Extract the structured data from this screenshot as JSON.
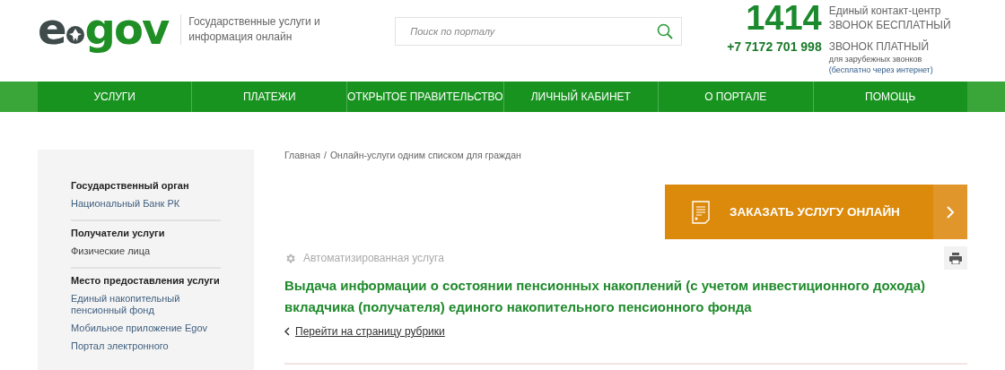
{
  "header": {
    "logo": {
      "left": "e",
      "right": "gov"
    },
    "tagline": "Государственные услуги и информация онлайн",
    "search": {
      "placeholder": "Поиск по порталу"
    },
    "contact": {
      "short_number": "1414",
      "short_label": "Единый контакт-центр",
      "short_note": "ЗВОНОК БЕСПЛАТНЫЙ",
      "phone": "+7 7172 701 998",
      "phone_note": "ЗВОНОК ПЛАТНЫЙ",
      "foreign_note": "для зарубежных звонков",
      "internet_note": "(бесплатно через интернет)"
    }
  },
  "nav": [
    "УСЛУГИ",
    "ПЛАТЕЖИ",
    "ОТКРЫТОЕ ПРАВИТЕЛЬСТВО",
    "ЛИЧНЫЙ КАБИНЕТ",
    "О ПОРТАЛЕ",
    "ПОМОЩЬ"
  ],
  "sidebar": [
    {
      "heading": "Государственный орган",
      "items": [
        {
          "text": "Национальный Банк РК",
          "kind": "link"
        }
      ]
    },
    {
      "heading": "Получатели услуги",
      "items": [
        {
          "text": "Физические лица",
          "kind": "plain"
        }
      ]
    },
    {
      "heading": "Место предоставления услуги",
      "items": [
        {
          "text": "Единый накопительный пенсионный фонд",
          "kind": "link"
        },
        {
          "text": "Мобильное приложение Egov",
          "kind": "link"
        },
        {
          "text": "Портал электронного",
          "kind": "link"
        }
      ]
    }
  ],
  "breadcrumbs": [
    "Главная",
    "Онлайн-услуги одним списком для граждан"
  ],
  "breadcrumb_separator": "/",
  "order_button": {
    "label": "ЗАКАЗАТЬ УСЛУГУ ОНЛАЙН"
  },
  "service_type": "Автоматизированная услуга",
  "title": "Выдача информации о состоянии пенсионных накоплений (с учетом инвестиционного дохода) вкладчика (получателя) единого накопительного пенсионного фонда",
  "back_link": "Перейти на страницу рубрики"
}
